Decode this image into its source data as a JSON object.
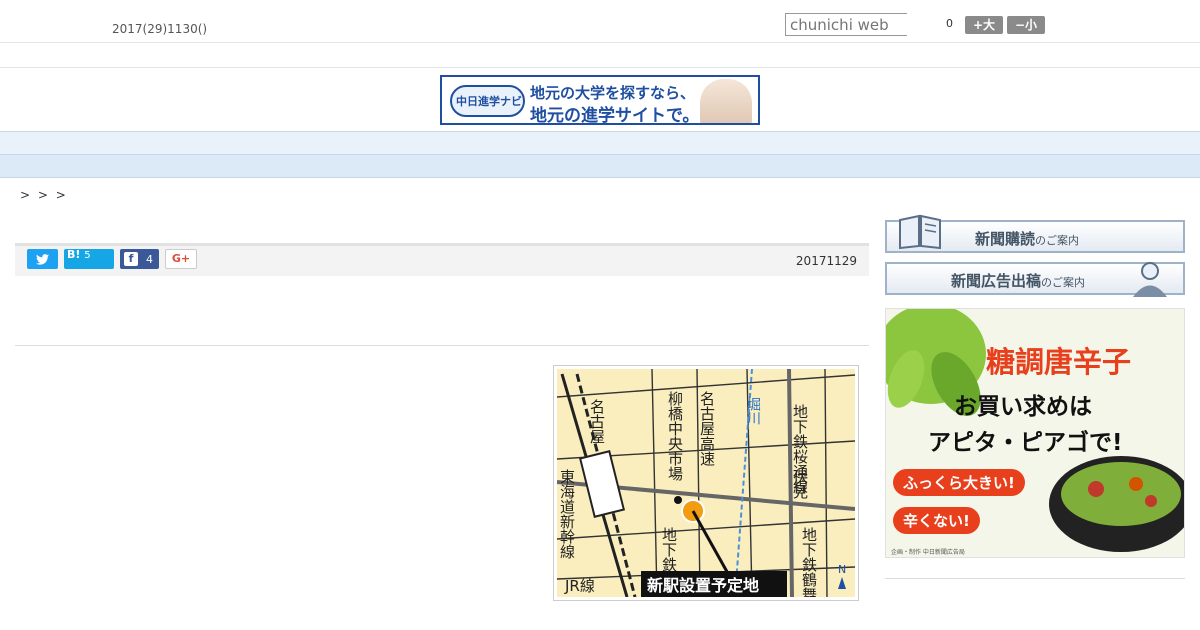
{
  "header": {
    "date": "2017(29)1130()",
    "search_placeholder": "chunichi web",
    "count": "0",
    "font_large_label": "+大",
    "font_small_label": "−小"
  },
  "top_banner": {
    "logo_text": "中日進学ナビ",
    "line1": "地元の大学を探すなら、",
    "line2": "地元の進学サイトで。"
  },
  "nav": {
    "items": [
      " ",
      " ",
      " ",
      " ",
      " ",
      " ",
      " ",
      " ",
      " "
    ]
  },
  "breadcrumb": "> > >",
  "article": {
    "hatena_count": "5",
    "facebook_count": "4",
    "date": "20171129"
  },
  "map": {
    "labels": {
      "nagoya": "名古屋",
      "tokaido": "東海道新幹線",
      "yanagibashi": "柳橋中央市場",
      "expressway": "名古屋高速",
      "horikawa": "堀川",
      "sakuradori": "地下鉄桜通線",
      "fushimi": "伏見",
      "higashiyama": "地下鉄東山線",
      "tsurumai": "地下鉄鶴舞線",
      "jr": "JR線",
      "new_station": "新駅設置予定地",
      "north": "N"
    }
  },
  "sidebar": {
    "subscribe_main": "新聞購読",
    "subscribe_small": "のご案内",
    "advertise_main": "新聞広告出稿",
    "advertise_small": "のご案内",
    "ad": {
      "title": "糖調唐辛子",
      "line2": "お買い求めは",
      "line3": "アピタ・ピアゴで!",
      "pill1": "ふっくら大きい!",
      "pill2": "辛くない!",
      "credit": "企画・制作 中日新聞広告局"
    }
  },
  "colors": {
    "nav_bg": "#e9f1fa",
    "nav_sub_bg": "#dce9f6",
    "twitter": "#1da1f2",
    "hatena": "#16a6e5",
    "facebook": "#3b5998",
    "ad_accent": "#e8401c",
    "map_bg": "#faeebf",
    "banner_blue": "#1f4fa0"
  }
}
